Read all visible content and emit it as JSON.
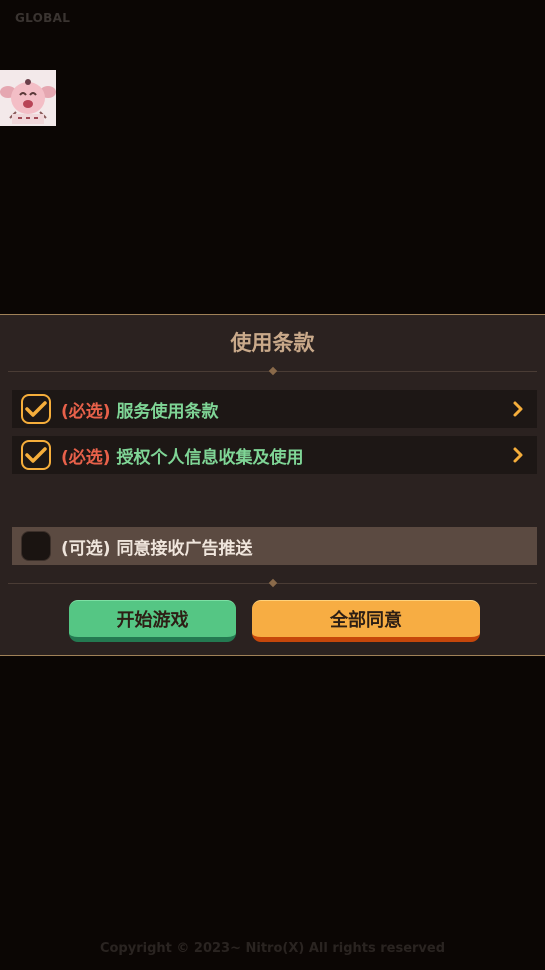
{
  "header": {
    "region_label": "GLOBAL"
  },
  "terms_dialog": {
    "title": "使用条款",
    "items": [
      {
        "tag": "(必选)",
        "label": "服务使用条款",
        "checked": true,
        "has_arrow": true
      },
      {
        "tag": "(必选)",
        "label": "授权个人信息收集及使用",
        "checked": true,
        "has_arrow": true
      },
      {
        "tag": "(可选)",
        "label": "同意接收广告推送",
        "checked": false,
        "has_arrow": false
      }
    ],
    "buttons": {
      "start_game": "开始游戏",
      "agree_all": "全部同意"
    }
  },
  "footer": {
    "copyright": "Copyright © 2023~ Nitro(X) All rights reserved"
  },
  "colors": {
    "accent_orange": "#f6ae3b",
    "required_red": "#e8614a",
    "label_green": "#7fd596",
    "start_button_green": "#55c684",
    "panel_background": "#2b2220"
  },
  "icons": [
    "check-icon",
    "chevron-right-icon"
  ]
}
